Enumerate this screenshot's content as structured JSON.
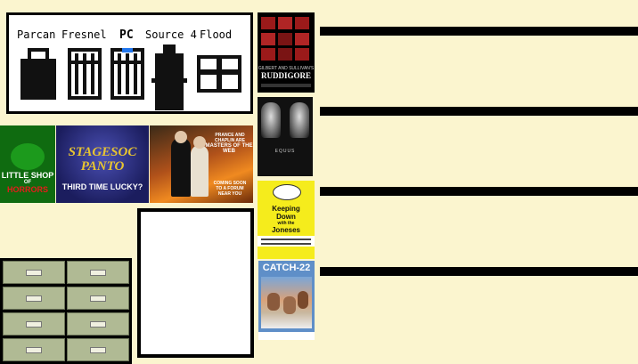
{
  "lights": {
    "labels": [
      "Parcan",
      "Fresnel",
      "PC",
      "Source 4",
      "Flood"
    ]
  },
  "posters": {
    "ruddigore": {
      "top": "GILBERT AND SULLIVAN'S",
      "title": "RUDDIGORE"
    },
    "equus": {
      "title": "EQUUS"
    },
    "keeping_down": {
      "line1": "Keeping",
      "line2": "Down",
      "line3": "with the",
      "line4": "Joneses"
    },
    "catch22": {
      "title": "CATCH-22"
    },
    "little_shop": {
      "line1": "LITTLE SHOP",
      "line2": "OF",
      "line3": "HORRORS"
    },
    "third_time": {
      "title": "STAGESOC PANTO",
      "sub": "THIRD TIME LUCKY?"
    },
    "masters": {
      "line1": "PRANCE AND CHAPLIN ARE",
      "line2": "MASTERS OF THE WEB",
      "line3": "COMING SOON",
      "line4": "TO A FORUM",
      "line5": "NEAR YOU"
    }
  }
}
